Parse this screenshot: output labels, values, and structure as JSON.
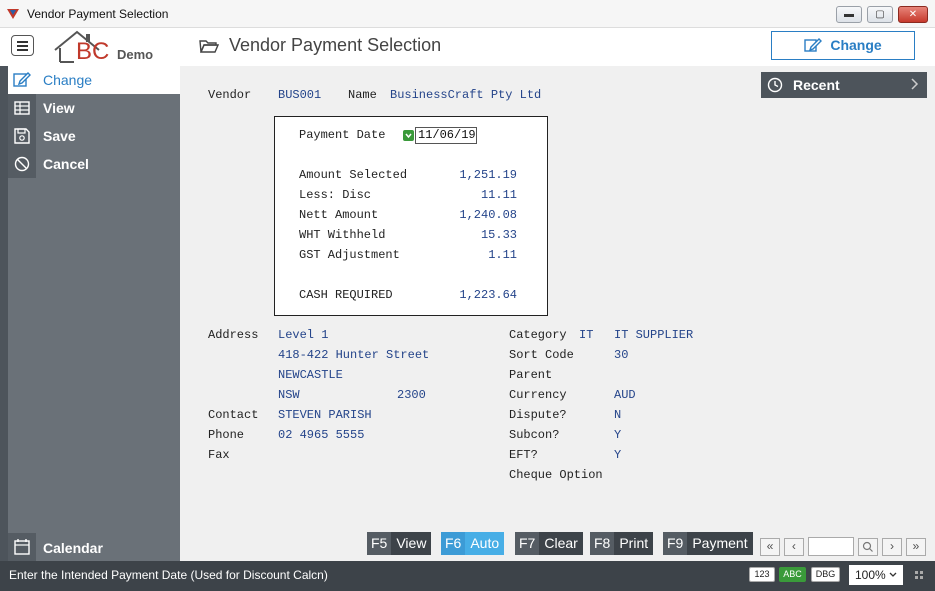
{
  "window": {
    "title": "Vendor Payment Selection",
    "minimize": "▬",
    "maximize": "▢",
    "close": "✕"
  },
  "header": {
    "logo_text": "BC",
    "logo_demo": "Demo",
    "page_title": "Vendor Payment Selection",
    "change_label": "Change"
  },
  "sidebar": {
    "items": [
      {
        "label": "Change",
        "icon": "edit-icon"
      },
      {
        "label": "View",
        "icon": "table-icon"
      },
      {
        "label": "Save",
        "icon": "save-icon"
      },
      {
        "label": "Cancel",
        "icon": "cancel-icon"
      }
    ],
    "calendar_label": "Calendar"
  },
  "recent": {
    "label": "Recent"
  },
  "vendor": {
    "vendor_label": "Vendor",
    "vendor_code": "BUS001",
    "name_label": "Name",
    "name_value": "BusinessCraft Pty Ltd"
  },
  "payment": {
    "date_label": "Payment Date",
    "date_value": "11/06/19",
    "rows": [
      {
        "label": "Amount Selected",
        "value": "1,251.19"
      },
      {
        "label": "Less: Disc",
        "value": "11.11"
      },
      {
        "label": "Nett Amount",
        "value": "1,240.08"
      },
      {
        "label": "WHT Withheld",
        "value": "15.33"
      },
      {
        "label": "GST Adjustment",
        "value": "1.11"
      }
    ],
    "cash_label": "CASH REQUIRED",
    "cash_value": "1,223.64"
  },
  "details_left": {
    "address_label": "Address",
    "address_line1": "Level 1",
    "address_line2": "418-422 Hunter Street",
    "address_line3": "NEWCASTLE",
    "state": "NSW",
    "postcode": "2300",
    "contact_label": "Contact",
    "contact_value": "STEVEN PARISH",
    "phone_label": "Phone",
    "phone_value": "02 4965 5555",
    "fax_label": "Fax"
  },
  "details_right": {
    "category_label": "Category",
    "category_code": "IT",
    "category_desc": "IT SUPPLIER",
    "sort_label": "Sort Code",
    "sort_value": "30",
    "parent_label": "Parent",
    "currency_label": "Currency",
    "currency_value": "AUD",
    "dispute_label": "Dispute?",
    "dispute_value": "N",
    "subcon_label": "Subcon?",
    "subcon_value": "Y",
    "eft_label": "EFT?",
    "eft_value": "Y",
    "cheque_label": "Cheque Option"
  },
  "fkeys": [
    {
      "key": "F5",
      "label": "View"
    },
    {
      "key": "F6",
      "label": "Auto"
    },
    {
      "key": "F7",
      "label": "Clear"
    },
    {
      "key": "F8",
      "label": "Print"
    },
    {
      "key": "F9",
      "label": "Payment"
    }
  ],
  "status": {
    "message": "Enter the Intended Payment Date (Used for Discount Calcn)",
    "badge_num": "123",
    "badge_abc": "ABC",
    "badge_dbg": "DBG",
    "zoom": "100%"
  }
}
